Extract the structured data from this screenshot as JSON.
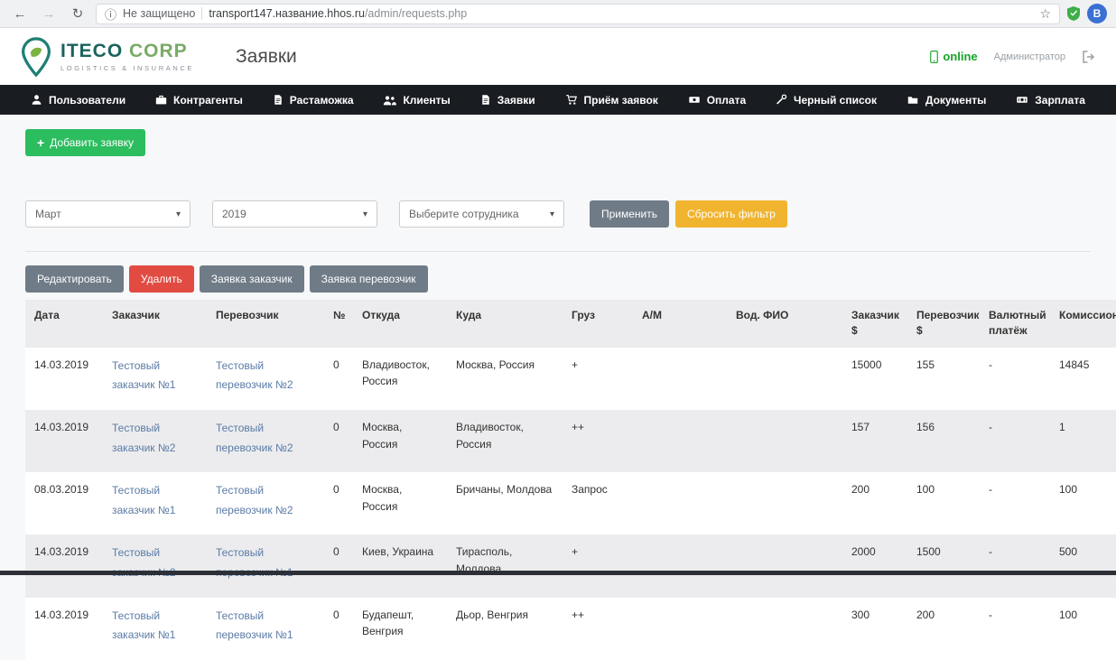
{
  "browser": {
    "security_label": "Не защищено",
    "url_host": "transport147.название.hhos.ru",
    "url_path": "/admin/requests.php",
    "profile_letter": "В"
  },
  "icons": {
    "back": "←",
    "forward": "→",
    "reload": "↻",
    "info": "ⓘ",
    "star": "☆",
    "caret": "▾",
    "plus": "+"
  },
  "header": {
    "logo_name": "ITECO",
    "logo_suffix": "CORP",
    "logo_subtitle": "LOGISTICS & INSURANCE",
    "page_title": "Заявки",
    "online_label": "online",
    "user_role": "Администратор"
  },
  "nav": {
    "items": [
      {
        "id": "users",
        "label": "Пользователи",
        "icon": "user-icon"
      },
      {
        "id": "contractors",
        "label": "Контрагенты",
        "icon": "briefcase-icon"
      },
      {
        "id": "customs",
        "label": "Растаможка",
        "icon": "document-icon"
      },
      {
        "id": "clients",
        "label": "Клиенты",
        "icon": "people-icon"
      },
      {
        "id": "requests",
        "label": "Заявки",
        "icon": "file-icon"
      },
      {
        "id": "intake",
        "label": "Приём заявок",
        "icon": "cart-icon"
      },
      {
        "id": "payment",
        "label": "Оплата",
        "icon": "money-icon"
      },
      {
        "id": "blacklist",
        "label": "Черный список",
        "icon": "tool-icon"
      },
      {
        "id": "documents",
        "label": "Документы",
        "icon": "folder-icon"
      },
      {
        "id": "salary",
        "label": "Зарплата",
        "icon": "wallet-icon"
      }
    ]
  },
  "toolbar": {
    "add_request_label": "Добавить заявку"
  },
  "filters": {
    "month_value": "Март",
    "year_value": "2019",
    "employee_placeholder": "Выберите сотрудника",
    "apply_label": "Применить",
    "reset_label": "Сбросить фильтр"
  },
  "actions": {
    "edit_label": "Редактировать",
    "delete_label": "Удалить",
    "customer_request_label": "Заявка заказчик",
    "carrier_request_label": "Заявка перевозчик"
  },
  "table": {
    "columns": [
      {
        "key": "date",
        "label": "Дата"
      },
      {
        "key": "customer",
        "label": "Заказчик",
        "link": true
      },
      {
        "key": "carrier",
        "label": "Перевозчик",
        "link": true
      },
      {
        "key": "num",
        "label": "№"
      },
      {
        "key": "from",
        "label": "Откуда"
      },
      {
        "key": "to",
        "label": "Куда"
      },
      {
        "key": "cargo",
        "label": "Груз"
      },
      {
        "key": "am",
        "label": "А/М"
      },
      {
        "key": "driver",
        "label": "Вод. ФИО"
      },
      {
        "key": "customer_usd",
        "label": "Заказчик $"
      },
      {
        "key": "carrier_usd",
        "label": "Перевозчик $"
      },
      {
        "key": "currency",
        "label": "Валютный платёж"
      },
      {
        "key": "commission",
        "label": "Комиссион"
      }
    ],
    "rows": [
      {
        "date": "14.03.2019",
        "customer": "Тестовый заказчик №1",
        "carrier": "Тестовый перевозчик №2",
        "num": "0",
        "from": "Владивосток, Россия",
        "to": "Москва, Россия",
        "cargo": "+",
        "am": "",
        "driver": "",
        "customer_usd": "15000",
        "carrier_usd": "155",
        "currency": "-",
        "commission": "14845"
      },
      {
        "date": "14.03.2019",
        "customer": "Тестовый заказчик №2",
        "carrier": "Тестовый перевозчик №2",
        "num": "0",
        "from": "Москва, Россия",
        "to": "Владивосток, Россия",
        "cargo": "++",
        "am": "",
        "driver": "",
        "customer_usd": "157",
        "carrier_usd": "156",
        "currency": "-",
        "commission": "1"
      },
      {
        "date": "08.03.2019",
        "customer": "Тестовый заказчик №1",
        "carrier": "Тестовый перевозчик №2",
        "num": "0",
        "from": "Москва, Россия",
        "to": "Бричаны, Молдова",
        "cargo": "Запрос",
        "am": "",
        "driver": "",
        "customer_usd": "200",
        "carrier_usd": "100",
        "currency": "-",
        "commission": "100"
      },
      {
        "date": "14.03.2019",
        "customer": "Тестовый заказчик №2",
        "carrier": "Тестовый перевозчик №1",
        "num": "0",
        "from": "Киев, Украина",
        "to": "Тирасполь, Молдова",
        "cargo": "+",
        "am": "",
        "driver": "",
        "customer_usd": "2000",
        "carrier_usd": "1500",
        "currency": "-",
        "commission": "500"
      },
      {
        "date": "14.03.2019",
        "customer": "Тестовый заказчик №1",
        "carrier": "Тестовый перевозчик №1",
        "num": "0",
        "from": "Будапешт, Венгрия",
        "to": "Дьор, Венгрия",
        "cargo": "++",
        "am": "",
        "driver": "",
        "customer_usd": "300",
        "carrier_usd": "200",
        "currency": "-",
        "commission": "100"
      }
    ]
  },
  "colors": {
    "accent_green": "#2bbd5e",
    "accent_orange": "#f0b42f",
    "accent_red": "#e14b42",
    "accent_gray": "#6f7b87",
    "link_blue": "#5a7ba6",
    "online_green": "#17a329",
    "nav_bg": "#191c21"
  }
}
